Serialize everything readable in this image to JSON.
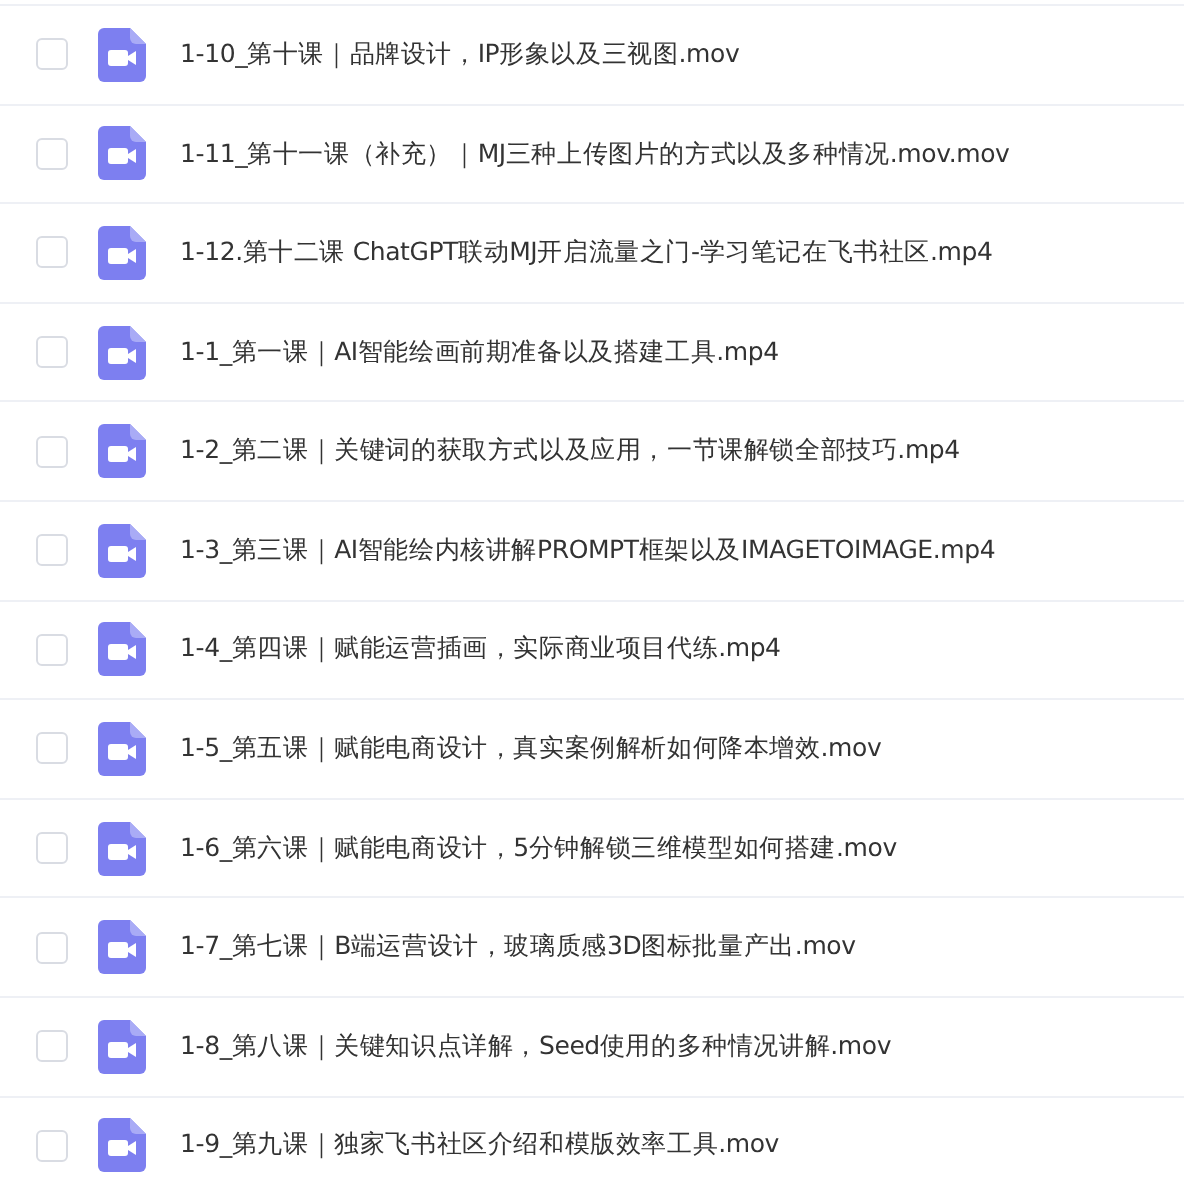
{
  "files": [
    {
      "name": "1-10_第十课｜品牌设计，IP形象以及三视图.mov",
      "checked": false
    },
    {
      "name": "1-11_第十一课（补充）｜MJ三种上传图片的方式以及多种情况.mov.mov",
      "checked": false
    },
    {
      "name": "1-12.第十二课 ChatGPT联动MJ开启流量之门-学习笔记在飞书社区.mp4",
      "checked": false
    },
    {
      "name": "1-1_第一课｜AI智能绘画前期准备以及搭建工具.mp4",
      "checked": false
    },
    {
      "name": "1-2_第二课｜关键词的获取方式以及应用，一节课解锁全部技巧.mp4",
      "checked": false
    },
    {
      "name": "1-3_第三课｜AI智能绘内核讲解PROMPT框架以及IMAGETOIMAGE.mp4",
      "checked": false
    },
    {
      "name": "1-4_第四课｜赋能运营插画，实际商业项目代练.mp4",
      "checked": false
    },
    {
      "name": "1-5_第五课｜赋能电商设计，真实案例解析如何降本增效.mov",
      "checked": false
    },
    {
      "name": "1-6_第六课｜赋能电商设计，5分钟解锁三维模型如何搭建.mov",
      "checked": false
    },
    {
      "name": "1-7_第七课｜B端运营设计，玻璃质感3D图标批量产出.mov",
      "checked": false
    },
    {
      "name": "1-8_第八课｜关键知识点详解，Seed使用的多种情况讲解.mov",
      "checked": false
    },
    {
      "name": "1-9_第九课｜独家飞书社区介绍和模版效率工具.mov",
      "checked": false
    }
  ]
}
